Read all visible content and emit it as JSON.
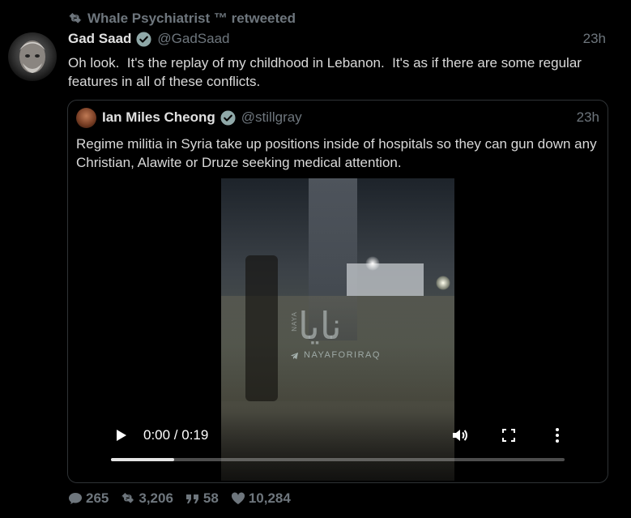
{
  "retweet": {
    "icon": "retweet-icon",
    "text": "Whale Psychiatrist ™ retweeted"
  },
  "tweet": {
    "name": "Gad Saad",
    "handle": "@GadSaad",
    "time": "23h",
    "text": "Oh look.  It's the replay of my childhood in Lebanon.  It's as if there are some regular features in all of these conflicts."
  },
  "quote": {
    "name": "Ian Miles Cheong",
    "handle": "@stillgray",
    "time": "23h",
    "text": "Regime militia in Syria take up positions inside of hospitals so they can gun down any Christian, Alawite or Druze seeking medical attention.",
    "video": {
      "watermark_arabic": "نايا",
      "watermark_side": "NAYA",
      "watermark_handle": "NAYAFORIRAQ",
      "time_display": "0:00 / 0:19",
      "progress": 0.14
    }
  },
  "stats": {
    "replies": "265",
    "retweets": "3,206",
    "quotes": "58",
    "likes": "10,284"
  },
  "colors": {
    "background": "#000000",
    "text": "#d9d9d9",
    "muted": "#6e767d",
    "verified": "#8fa8a8",
    "border": "#2f3336"
  }
}
